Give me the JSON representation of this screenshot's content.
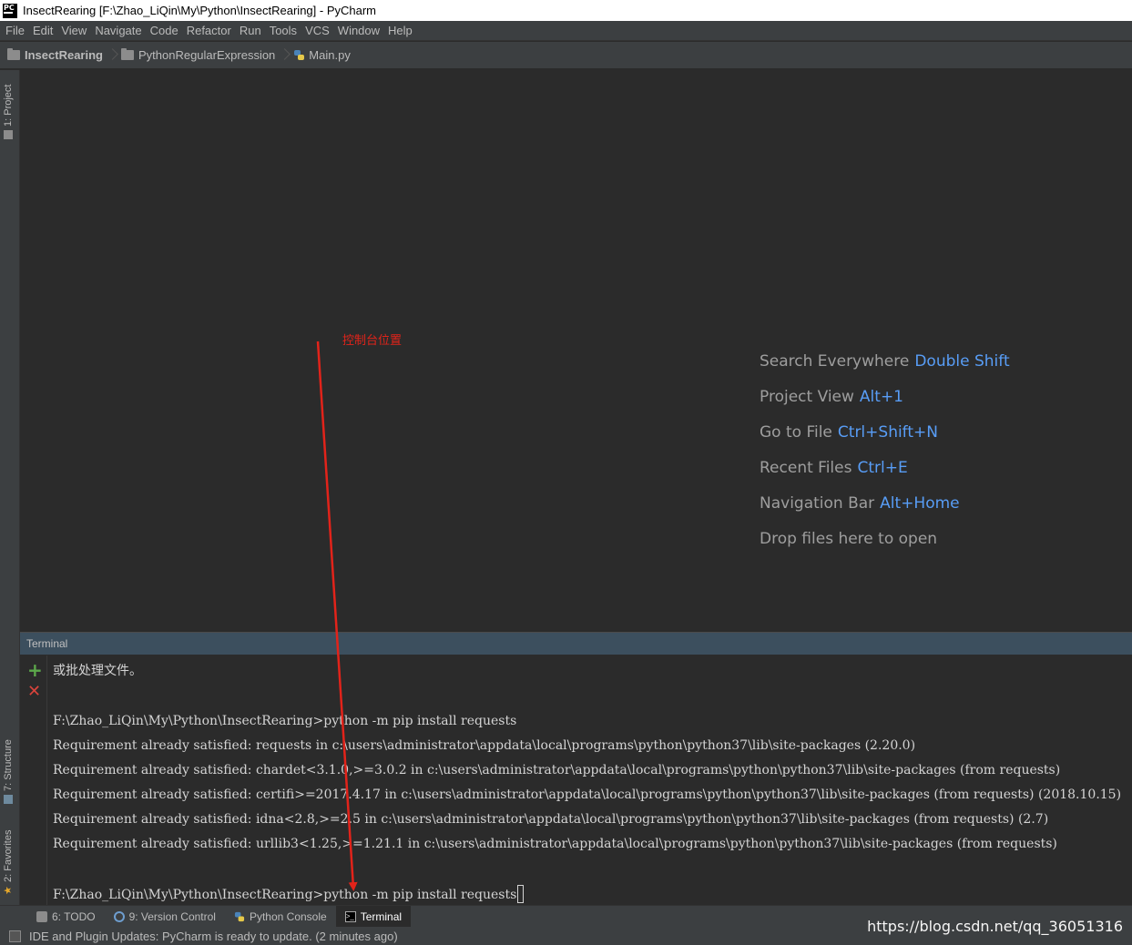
{
  "window": {
    "title": "InsectRearing [F:\\Zhao_LiQin\\My\\Python\\InsectRearing] - PyCharm",
    "logo_text": "PC"
  },
  "menu": [
    "File",
    "Edit",
    "View",
    "Navigate",
    "Code",
    "Refactor",
    "Run",
    "Tools",
    "VCS",
    "Window",
    "Help"
  ],
  "breadcrumb": {
    "project": "InsectRearing",
    "folder": "PythonRegularExpression",
    "file": "Main.py"
  },
  "left_tool_tabs": {
    "project": "1: Project",
    "structure": "7: Structure",
    "favorites": "2: Favorites"
  },
  "editor_hints": [
    {
      "label": "Search Everywhere",
      "shortcut": "Double Shift"
    },
    {
      "label": "Project View",
      "shortcut": "Alt+1"
    },
    {
      "label": "Go to File",
      "shortcut": "Ctrl+Shift+N"
    },
    {
      "label": "Recent Files",
      "shortcut": "Ctrl+E"
    },
    {
      "label": "Navigation Bar",
      "shortcut": "Alt+Home"
    },
    {
      "label": "Drop files here to open",
      "shortcut": ""
    }
  ],
  "annotation": {
    "text": "控制台位置",
    "color": "#e2231a"
  },
  "terminal": {
    "title": "Terminal",
    "lines": [
      "或批处理文件。",
      "",
      "F:\\Zhao_LiQin\\My\\Python\\InsectRearing>python -m pip install requests",
      "Requirement already satisfied: requests in c:\\users\\administrator\\appdata\\local\\programs\\python\\python37\\lib\\site-packages (2.20.0)",
      "Requirement already satisfied: chardet<3.1.0,>=3.0.2 in c:\\users\\administrator\\appdata\\local\\programs\\python\\python37\\lib\\site-packages (from requests)",
      "Requirement already satisfied: certifi>=2017.4.17 in c:\\users\\administrator\\appdata\\local\\programs\\python\\python37\\lib\\site-packages (from requests) (2018.10.15)",
      "Requirement already satisfied: idna<2.8,>=2.5 in c:\\users\\administrator\\appdata\\local\\programs\\python\\python37\\lib\\site-packages (from requests) (2.7)",
      "Requirement already satisfied: urllib3<1.25,>=1.21.1 in c:\\users\\administrator\\appdata\\local\\programs\\python\\python37\\lib\\site-packages (from requests)",
      "",
      "F:\\Zhao_LiQin\\My\\Python\\InsectRearing>python -m pip install requests"
    ]
  },
  "bottom_tabs": [
    {
      "label": "6: TODO",
      "icon": "todo-icon",
      "active": false
    },
    {
      "label": "9: Version Control",
      "icon": "version-control-icon",
      "active": false
    },
    {
      "label": "Python Console",
      "icon": "python-console-icon",
      "active": false
    },
    {
      "label": "Terminal",
      "icon": "terminal-icon",
      "active": true
    }
  ],
  "status": {
    "message": "IDE and Plugin Updates: PyCharm is ready to update. (2 minutes ago)"
  },
  "watermark": "https://blog.csdn.net/qq_36051316",
  "colors": {
    "editor_bg": "#2b2b2b",
    "panel_bg": "#3c3f41",
    "shortcut_blue": "#589df6",
    "terminal_header": "#3c4f5e"
  }
}
